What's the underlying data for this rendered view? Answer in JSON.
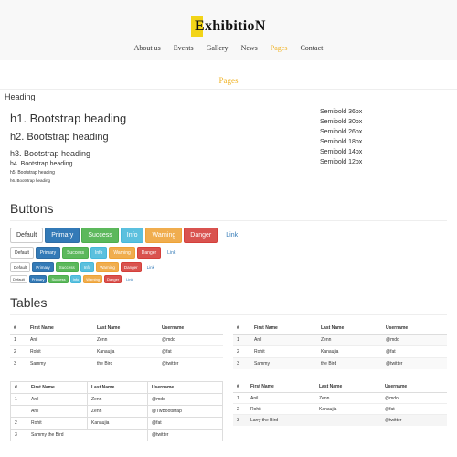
{
  "brand": {
    "name": "ExhibitioN",
    "accent": "#f2d418"
  },
  "nav": {
    "items": [
      {
        "label": "About us"
      },
      {
        "label": "Events"
      },
      {
        "label": "Gallery"
      },
      {
        "label": "News"
      },
      {
        "label": "Pages"
      },
      {
        "label": "Contact"
      }
    ],
    "active_color": "#f0b429"
  },
  "page_title": "Pages",
  "typography": {
    "heading_label": "Heading",
    "headings": [
      "h1. Bootstrap heading",
      "h2. Bootstrap heading",
      "h3. Bootstrap heading",
      "h4. Bootstrap heading",
      "h5. Bootstrap heading",
      "h6. Bootstrap heading"
    ],
    "semibold": [
      "Semibold 36px",
      "Semibold 30px",
      "Semibold 26px",
      "Semibold 18px",
      "Semibold 14px",
      "Semibold 12px"
    ]
  },
  "buttons": {
    "title": "Buttons",
    "labels": {
      "default": "Default",
      "primary": "Primary",
      "success": "Success",
      "info": "Info",
      "warning": "Warning",
      "danger": "Danger",
      "link": "Link"
    },
    "colors": {
      "primary": "#337ab7",
      "success": "#5cb85c",
      "info": "#5bc0de",
      "warning": "#f0ad4e",
      "danger": "#d9534f"
    }
  },
  "tables": {
    "title": "Tables",
    "headers": [
      "#",
      "First Name",
      "Last Name",
      "Username"
    ],
    "basic_rows": [
      [
        "1",
        "Anil",
        "Zenn",
        "@mdo"
      ],
      [
        "2",
        "Rohit",
        "Kanaujia",
        "@fat"
      ],
      [
        "3",
        "Sammy",
        "the Bird",
        "@twitter"
      ]
    ],
    "bordered_rows": [
      [
        "1",
        "Anil",
        "Zenn",
        "@mdo"
      ],
      [
        "",
        "Anil",
        "Zenn",
        "@TwBootstrap"
      ],
      [
        "2",
        "Rohit",
        "Kanaujia",
        "@fat"
      ],
      [
        "3",
        "Sammy the Bird",
        "",
        "@twitter"
      ]
    ],
    "hover_rows": [
      [
        "1",
        "Anil",
        "Zenn",
        "@mdo"
      ],
      [
        "2",
        "Rohit",
        "Kanaujia",
        "@fat"
      ],
      [
        "3",
        "Larry the Bird",
        "",
        "@twitter"
      ]
    ]
  }
}
